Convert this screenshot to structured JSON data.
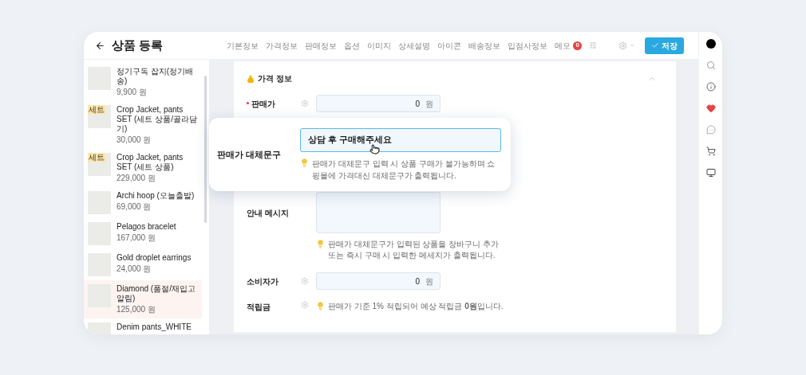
{
  "header": {
    "title": "상품 등록",
    "nav": [
      {
        "label": "기본정보"
      },
      {
        "label": "가격정보"
      },
      {
        "label": "판매정보"
      },
      {
        "label": "옵션"
      },
      {
        "label": "이미지"
      },
      {
        "label": "상세설명"
      },
      {
        "label": "아이콘"
      },
      {
        "label": "배송정보"
      },
      {
        "label": "입점사정보"
      },
      {
        "label": "메모",
        "badge": "0"
      }
    ],
    "save_button": "저장"
  },
  "product_list": [
    {
      "name": "정기구독 잡지(정기배송)",
      "price": "9,900 원",
      "selected": false
    },
    {
      "name": "Crop Jacket, pants SET (세트 상품/골라담기)",
      "price": "30,000 원",
      "badge": "세트",
      "selected": false
    },
    {
      "name": "Crop Jacket, pants SET (세트 상품)",
      "price": "229,000 원",
      "badge": "세트",
      "selected": false
    },
    {
      "name": "Archi hoop (오늘출발)",
      "price": "69,000 원",
      "selected": false
    },
    {
      "name": "Pelagos bracelet",
      "price": "167,000 원",
      "selected": false
    },
    {
      "name": "Gold droplet earrings",
      "price": "24,000 원",
      "selected": false
    },
    {
      "name": "Diamond (품절/재입고알림)",
      "price": "125,000 원",
      "selected": true
    },
    {
      "name": "Denim pants_WHITE",
      "selected": false
    }
  ],
  "section": {
    "title": "가격 정보",
    "fields": [
      {
        "kind": "input",
        "label": "판매가",
        "required": true,
        "settings": true,
        "value": "0",
        "unit": "원"
      },
      {
        "kind": "textarea",
        "label": "안내 메시지",
        "required": false,
        "settings": false,
        "hint": "판매가 대체문구가 입력된 상품을 장바구니 추가 또는 즉시 구매 시 입력한 메세지가 출력됩니다."
      },
      {
        "kind": "input",
        "label": "소비자가",
        "required": false,
        "settings": true,
        "value": "0",
        "unit": "원"
      },
      {
        "kind": "info",
        "label": "적립금",
        "required": false,
        "settings": true,
        "hint": "판매가 기준 1% 적립되어 예상 적립금 **0원**입니다."
      }
    ]
  },
  "popup": {
    "label": "판매가 대체문구",
    "value": "상담 후 구매해주세요",
    "hint": "판매가 대체문구 입력 시 상품 구매가 불가능하며 쇼핑몰에 가격대신 대체문구가 출력됩니다."
  }
}
